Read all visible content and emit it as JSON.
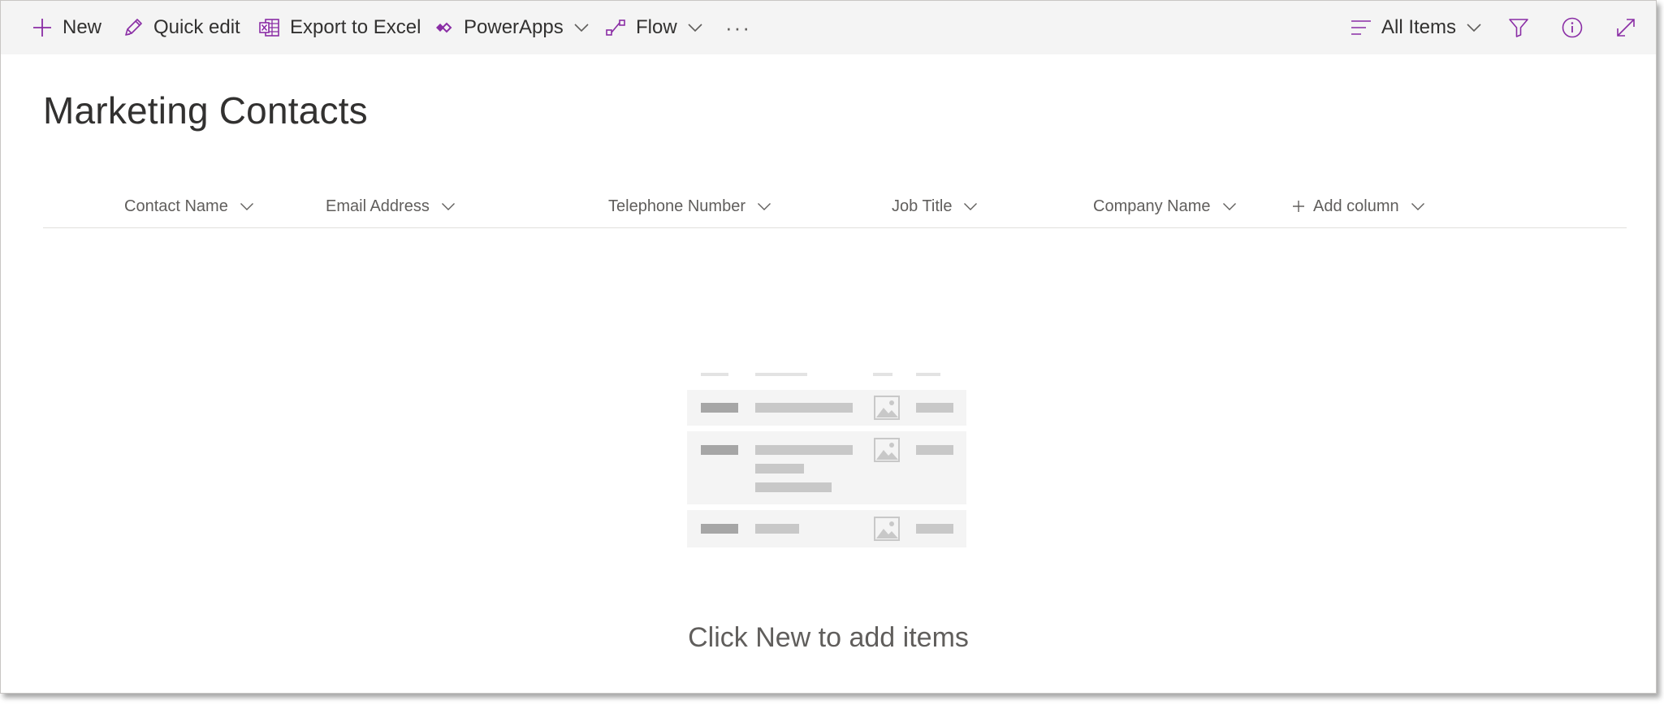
{
  "commandBar": {
    "new_label": "New",
    "quick_edit_label": "Quick edit",
    "export_label": "Export to Excel",
    "powerapps_label": "PowerApps",
    "flow_label": "Flow",
    "more_label": "···",
    "view_label": "All Items"
  },
  "icons": {
    "new": "plus-icon",
    "quick_edit": "pencil-icon",
    "export": "excel-icon",
    "powerapps": "powerapps-icon",
    "flow": "flow-icon",
    "view": "view-lines-icon",
    "filter": "filter-icon",
    "info": "info-icon",
    "expand": "expand-icon"
  },
  "page": {
    "title": "Marketing Contacts",
    "empty_message": "Click New to add items"
  },
  "columns": [
    {
      "label": "Contact Name"
    },
    {
      "label": "Email Address"
    },
    {
      "label": "Telephone Number"
    },
    {
      "label": "Job Title"
    },
    {
      "label": "Company Name"
    },
    {
      "label": "Add column"
    }
  ],
  "colors": {
    "accent": "#8a2da5",
    "commandbar_bg": "#f4f4f4",
    "text": "#323130",
    "muted": "#605e5c"
  }
}
